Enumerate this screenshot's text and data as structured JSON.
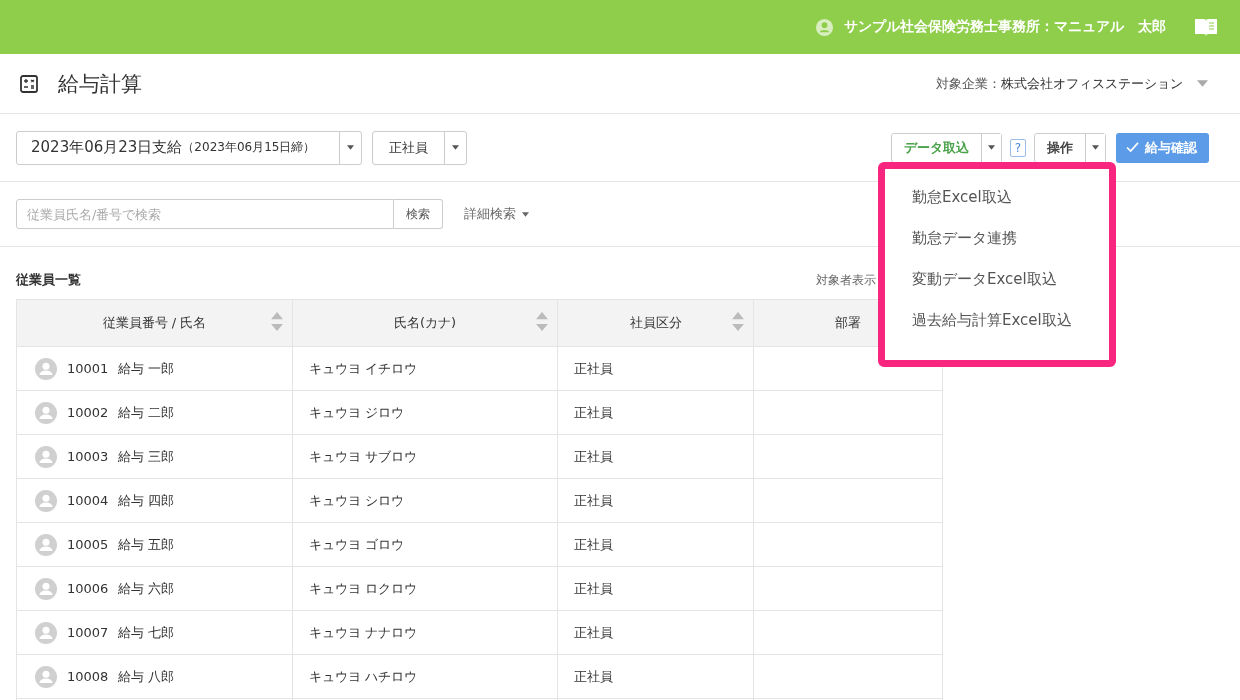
{
  "header": {
    "user": "サンプル社会保険労務士事務所：マニュアル　太郎"
  },
  "page": {
    "title": "給与計算",
    "company_label": "対象企業：",
    "company": "株式会社オフィスステーション"
  },
  "toolbar": {
    "payday": "2023年06月23日支給",
    "cutoff": "（2023年06月15日締）",
    "employee_type": "正社員",
    "import_button": "データ取込",
    "help": "?",
    "operation_button": "操作",
    "confirm_button": "給与確認"
  },
  "import_menu": {
    "items": [
      "勤怠Excel取込",
      "勤怠データ連携",
      "変動データExcel取込",
      "過去給与計算Excel取込"
    ]
  },
  "search": {
    "placeholder": "従業員氏名/番号で検索",
    "button": "検索",
    "advanced": "詳細検索"
  },
  "list": {
    "title": "従業員一覧",
    "display_label": "対象者表示"
  },
  "table": {
    "columns": [
      {
        "label": "従業員番号 / 氏名",
        "sortable": true
      },
      {
        "label": "氏名(カナ)",
        "sortable": true
      },
      {
        "label": "社員区分",
        "sortable": true
      },
      {
        "label": "部署"
      }
    ],
    "rows": [
      {
        "number": "10001",
        "name": "給与 一郎",
        "kana": "キュウヨ イチロウ",
        "type": "正社員"
      },
      {
        "number": "10002",
        "name": "給与 二郎",
        "kana": "キュウヨ ジロウ",
        "type": "正社員"
      },
      {
        "number": "10003",
        "name": "給与 三郎",
        "kana": "キュウヨ サブロウ",
        "type": "正社員"
      },
      {
        "number": "10004",
        "name": "給与 四郎",
        "kana": "キュウヨ シロウ",
        "type": "正社員"
      },
      {
        "number": "10005",
        "name": "給与 五郎",
        "kana": "キュウヨ ゴロウ",
        "type": "正社員"
      },
      {
        "number": "10006",
        "name": "給与 六郎",
        "kana": "キュウヨ ロクロウ",
        "type": "正社員"
      },
      {
        "number": "10007",
        "name": "給与 七郎",
        "kana": "キュウヨ ナナロウ",
        "type": "正社員"
      },
      {
        "number": "10008",
        "name": "給与 八郎",
        "kana": "キュウヨ ハチロウ",
        "type": "正社員"
      }
    ]
  }
}
